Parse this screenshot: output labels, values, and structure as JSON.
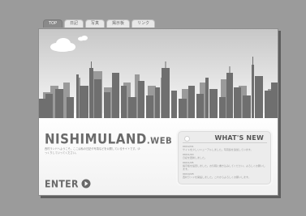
{
  "tabs": [
    {
      "label": "TOP",
      "active": true
    },
    {
      "label": "日記",
      "active": false
    },
    {
      "label": "写真",
      "active": false
    },
    {
      "label": "掲示板",
      "active": false
    },
    {
      "label": "リンク",
      "active": false
    }
  ],
  "logo": {
    "main": "NISHIMULAND",
    "suffix": ".WEB"
  },
  "tagline": "西村ランドへようこそ。ここは私の日記や写真などを公開しているサイトです。ゆっくりしていってください。",
  "news": {
    "title": "WHAT'S NEW",
    "items": [
      {
        "date": "09/12/01",
        "text": "サイトを少しリニューアルしました。写真館を追加しています。"
      },
      {
        "date": "09/11/20",
        "text": "日記を更新しました。"
      },
      {
        "date": "09/11/05",
        "text": "掲示板を設置しました。お気軽に書き込みしてください。よろしくお願いします。"
      },
      {
        "date": "09/10/28",
        "text": "西村ランドを開設しました。これからよろしくお願いします。"
      }
    ]
  },
  "enter": {
    "label": "ENTER"
  },
  "colors": {
    "background": "#9b9b9b",
    "accent": "#6a6a6a"
  }
}
